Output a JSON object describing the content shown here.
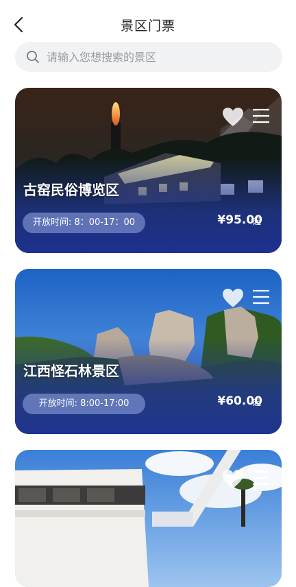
{
  "header": {
    "title": "景区门票",
    "back_icon": "chevron-left-icon"
  },
  "search": {
    "placeholder": "请输入您想搜索的景区",
    "value": "",
    "icon": "search-icon"
  },
  "cards": [
    {
      "name": "古窑民俗博览区",
      "hours": "开放时间: 8：00-17：00",
      "price": "¥95.00",
      "suffix": "起"
    },
    {
      "name": "江西怪石林景区",
      "hours": "开放时间: 8:00-17:00",
      "price": "¥60.00",
      "suffix": "起"
    },
    {
      "name": "",
      "hours": "",
      "price": "",
      "suffix": ""
    }
  ],
  "colors": {
    "card_overlay": "#1e3296",
    "hours_pill": "#96aae6",
    "search_bg": "#f1f2f4"
  }
}
